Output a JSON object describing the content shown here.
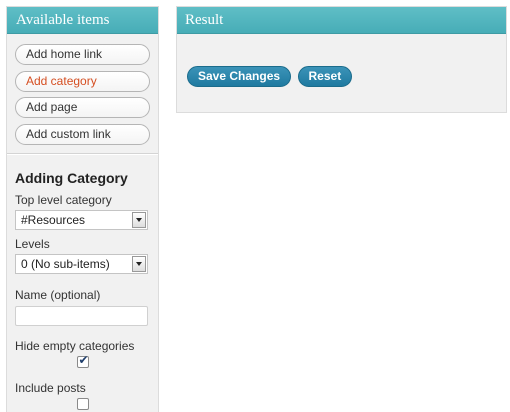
{
  "available_items": {
    "title": "Available items",
    "buttons": [
      {
        "label": "Add home link"
      },
      {
        "label": "Add category"
      },
      {
        "label": "Add page"
      },
      {
        "label": "Add custom link"
      }
    ]
  },
  "adding_category": {
    "title": "Adding Category",
    "top_level_label": "Top level category",
    "top_level_value": "#Resources",
    "levels_label": "Levels",
    "levels_value": "0 (No sub-items)",
    "name_label": "Name (optional)",
    "name_value": "",
    "hide_empty_label": "Hide empty categories",
    "hide_empty_checked": true,
    "include_posts_label": "Include posts",
    "include_posts_checked": false
  },
  "result": {
    "title": "Result",
    "save_label": "Save Changes",
    "reset_label": "Reset"
  },
  "colors": {
    "header": "#47adb7",
    "active_link": "#d54e21",
    "primary_button": "#1f7aa0"
  }
}
